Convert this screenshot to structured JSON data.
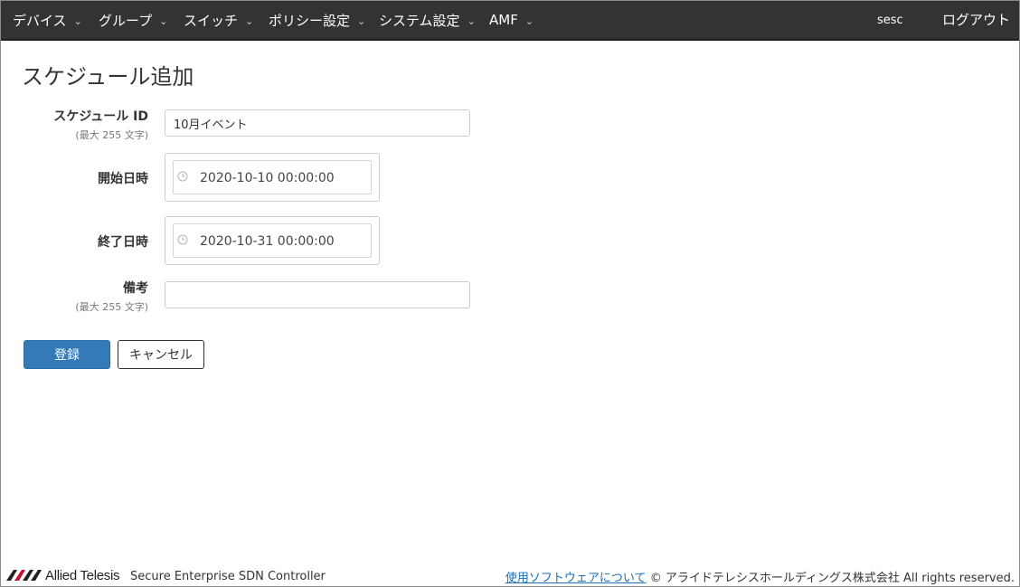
{
  "nav": {
    "items": [
      {
        "label": "デバイス"
      },
      {
        "label": "グループ"
      },
      {
        "label": "スイッチ"
      },
      {
        "label": "ポリシー設定"
      },
      {
        "label": "システム設定"
      },
      {
        "label": "AMF"
      }
    ],
    "caret": "⌄",
    "user": "sesc",
    "logout": "ログアウト"
  },
  "page": {
    "title": "スケジュール追加"
  },
  "form": {
    "schedule_id": {
      "label": "スケジュール ID",
      "hint": "(最大 255 文字)",
      "value": "10月イベント"
    },
    "start": {
      "label": "開始日時",
      "value": "2020-10-10 00:00:00"
    },
    "end": {
      "label": "終了日時",
      "value": "2020-10-31 00:00:00"
    },
    "remarks": {
      "label": "備考",
      "hint": "(最大 255 文字)",
      "value": ""
    }
  },
  "buttons": {
    "submit": "登録",
    "cancel": "キャンセル"
  },
  "footer": {
    "logo_text": "Allied Telesis",
    "product": "Secure Enterprise SDN Controller",
    "software_link": "使用ソフトウェアについて",
    "copyright": "© アライドテレシスホールディングス株式会社 All rights reserved."
  },
  "colors": {
    "navbar": "#333333",
    "primary": "#337ab7",
    "link": "#1a6fb5"
  }
}
